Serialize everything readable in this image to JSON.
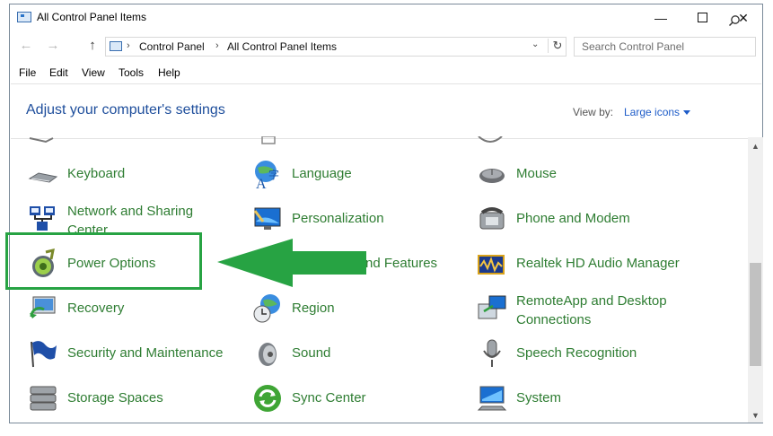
{
  "window": {
    "title": "All Control Panel Items"
  },
  "nav": {
    "breadcrumbs": [
      "Control Panel",
      "All Control Panel Items"
    ],
    "search_placeholder": "Search Control Panel"
  },
  "menu": [
    "File",
    "Edit",
    "View",
    "Tools",
    "Help"
  ],
  "header": {
    "title": "Adjust your computer's settings",
    "view_by_label": "View by:",
    "view_by_value": "Large icons"
  },
  "items": [
    {
      "label": "Keyboard",
      "icon": "keyboard-icon"
    },
    {
      "label": "Language",
      "icon": "language-icon"
    },
    {
      "label": "Mouse",
      "icon": "mouse-icon"
    },
    {
      "label": "Network and Sharing Center",
      "icon": "network-icon"
    },
    {
      "label": "Personalization",
      "icon": "personalization-icon"
    },
    {
      "label": "Phone and Modem",
      "icon": "phone-icon"
    },
    {
      "label": "Power Options",
      "icon": "battery-icon"
    },
    {
      "label": "nd Features",
      "icon": "programs-icon"
    },
    {
      "label": "Realtek HD Audio Manager",
      "icon": "audio-manager-icon"
    },
    {
      "label": "Recovery",
      "icon": "recovery-icon"
    },
    {
      "label": "Region",
      "icon": "globe-clock-icon"
    },
    {
      "label": "RemoteApp and Desktop Connections",
      "icon": "remote-desktop-icon"
    },
    {
      "label": "Security and Maintenance",
      "icon": "flag-icon"
    },
    {
      "label": "Sound",
      "icon": "speaker-icon"
    },
    {
      "label": "Speech Recognition",
      "icon": "microphone-icon"
    },
    {
      "label": "Storage Spaces",
      "icon": "storage-icon"
    },
    {
      "label": "Sync Center",
      "icon": "sync-icon"
    },
    {
      "label": "System",
      "icon": "computer-icon"
    }
  ],
  "annotation": {
    "highlight_color": "#27a343",
    "arrow_color": "#27a343",
    "target": "Power Options"
  }
}
